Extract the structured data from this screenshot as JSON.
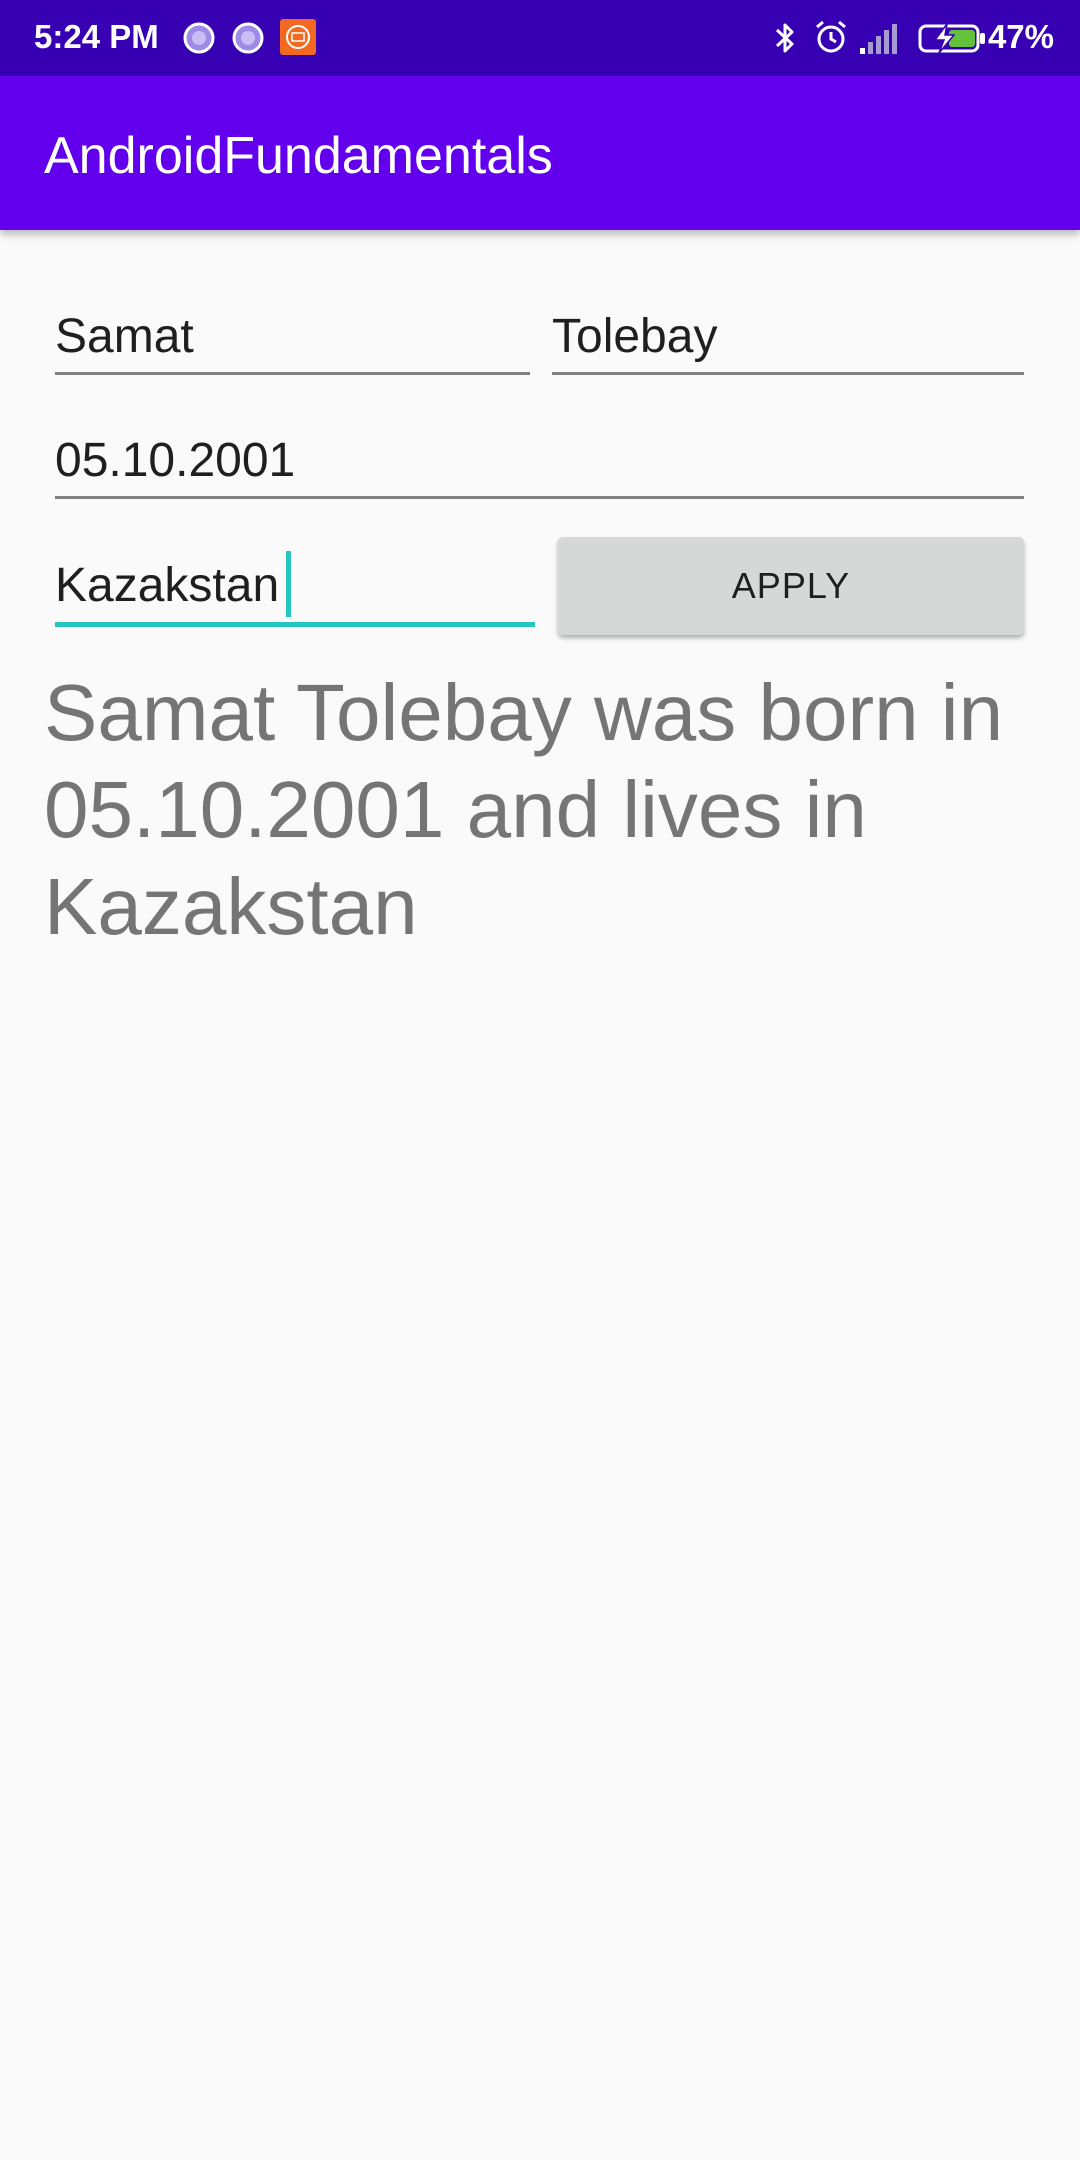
{
  "status_bar": {
    "time": "5:24 PM",
    "battery_percent": "47%",
    "left_icons": [
      "notification-dot-icon",
      "notification-dot-icon",
      "mi-app-icon"
    ],
    "right_icons": [
      "bluetooth-icon",
      "alarm-icon",
      "signal-icon",
      "battery-charging-icon"
    ],
    "background_color": "#3700b3"
  },
  "app_bar": {
    "title": "AndroidFundamentals",
    "background_color": "#6200ee"
  },
  "form": {
    "first_name": "Samat",
    "last_name": "Tolebay",
    "birth_date": "05.10.2001",
    "country": "Kazakstan",
    "focused_field": "country",
    "apply_label": "APPLY",
    "accent_color": "#26c6c0"
  },
  "result": {
    "text": "Samat Tolebay was born in 05.10.2001 and lives in Kazakstan"
  }
}
